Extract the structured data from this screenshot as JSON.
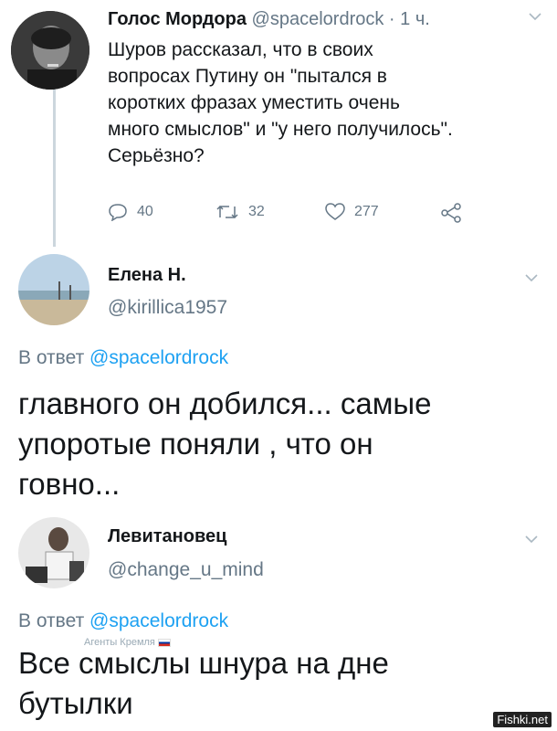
{
  "tweet1": {
    "author": "Голос Мордора",
    "handle": "@spacelordrock",
    "time": "· 1 ч.",
    "text_lines": [
      "Шуров рассказал, что в своих",
      "вопросах Путину он \"пытался в",
      "коротких фразах уместить очень",
      "много смыслов\" и \"у него получилось\".",
      "Серьёзно?"
    ],
    "replies": "40",
    "retweets": "32",
    "likes": "277",
    "icons": {
      "reply": "reply-icon",
      "retweet": "retweet-icon",
      "like": "heart-icon",
      "share": "share-icon",
      "more": "chevron-down-icon"
    }
  },
  "tweet2": {
    "author": "Елена Н.",
    "handle": "@kirillica1957",
    "reply_prefix": "В ответ",
    "reply_to": "@spacelordrock",
    "text_lines": [
      "главного он добился...  самые",
      "упоротые поняли , что он",
      "говно..."
    ]
  },
  "tweet3": {
    "author": "Левитановец",
    "handle": "@change_u_mind",
    "reply_prefix": "В ответ",
    "reply_to": "@spacelordrock",
    "text_lines": [
      "Все смыслы шнура на дне",
      "бутылки"
    ]
  },
  "overlay": {
    "agents_label": "Агенты Кремля",
    "watermark": "Fishki.net"
  },
  "colors": {
    "accent": "#1da1f2",
    "secondary": "#657786",
    "line": "#ccd6dd"
  }
}
